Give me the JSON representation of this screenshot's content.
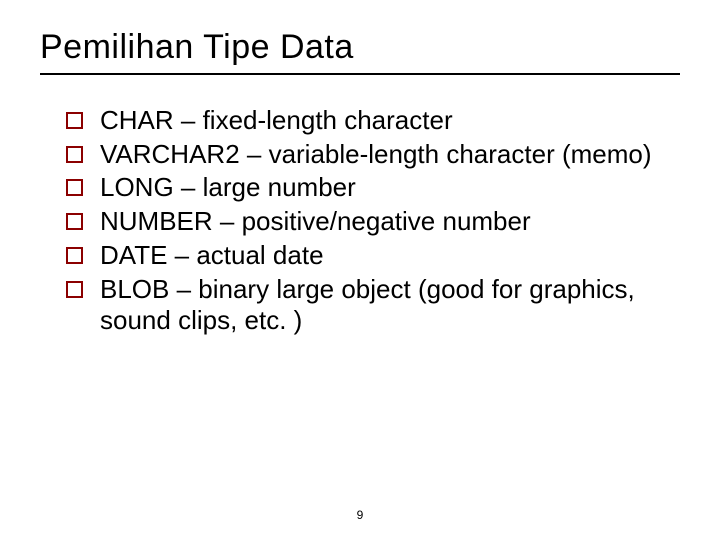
{
  "title": "Pemilihan Tipe Data",
  "bullets": [
    "CHAR – fixed-length character",
    "VARCHAR2 – variable-length character (memo)",
    "LONG – large number",
    "NUMBER – positive/negative number",
    "DATE – actual date",
    "BLOB – binary large object (good for graphics, sound clips, etc. )"
  ],
  "page_number": "9",
  "accent_color": "#8b0000"
}
